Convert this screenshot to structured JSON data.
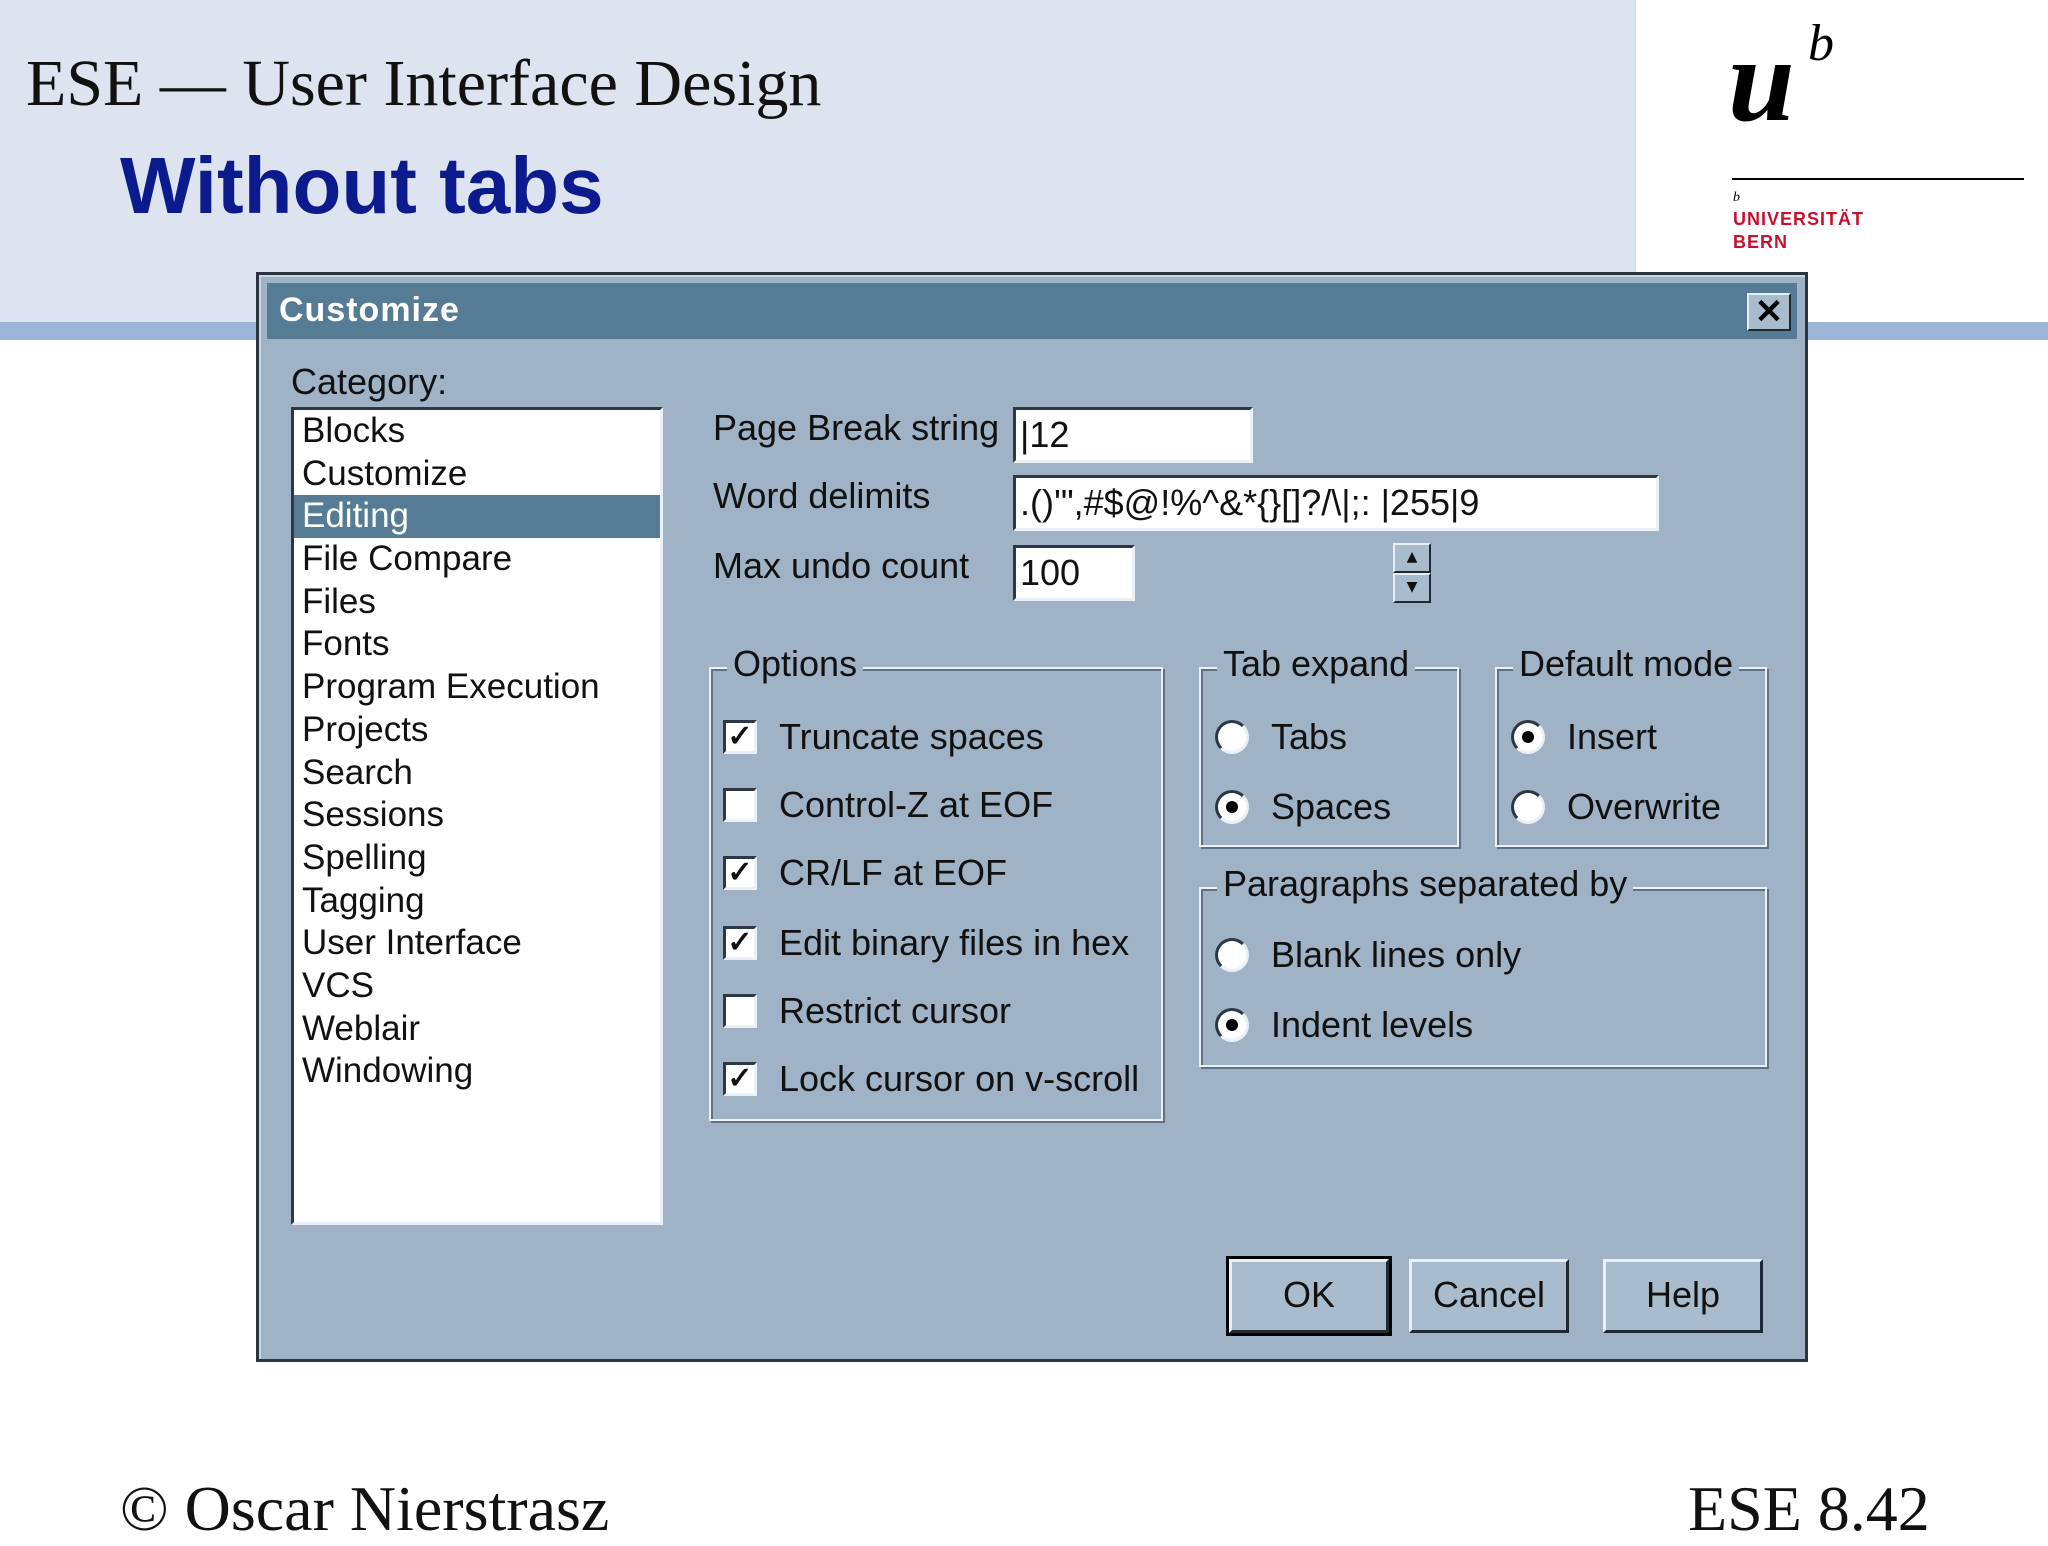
{
  "slide": {
    "course_title": "ESE — User Interface Design",
    "title": "Without tabs",
    "logo": {
      "u": "u",
      "b": "b",
      "small_b": "b",
      "line1": "UNIVERSITÄT",
      "line2": "BERN"
    },
    "footer_left": "© Oscar Nierstrasz",
    "footer_right": "ESE 8.42"
  },
  "dialog": {
    "title": "Customize",
    "close_label": "✕",
    "category_label": "Category:",
    "categories": [
      "Blocks",
      "Customize",
      "Editing",
      "File Compare",
      "Files",
      "Fonts",
      "Program Execution",
      "Projects",
      "Search",
      "Sessions",
      "Spelling",
      "Tagging",
      "User Interface",
      "VCS",
      "Weblair",
      "Windowing"
    ],
    "selected_category": "Editing",
    "page_break": {
      "label": "Page Break string",
      "value": "|12"
    },
    "word_delimits": {
      "label": "Word delimits",
      "value": ".()'\",#$@!%^&*{}[]?/\\|;: |255|9"
    },
    "max_undo": {
      "label": "Max undo count",
      "value": "100",
      "up": "▲",
      "down": "▼"
    },
    "options": {
      "title": "Options",
      "items": [
        {
          "label": "Truncate spaces",
          "checked": true
        },
        {
          "label": "Control-Z at EOF",
          "checked": false
        },
        {
          "label": "CR/LF at EOF",
          "checked": true
        },
        {
          "label": "Edit binary files in hex",
          "checked": true
        },
        {
          "label": "Restrict cursor",
          "checked": false
        },
        {
          "label": "Lock cursor on v-scroll",
          "checked": true
        }
      ]
    },
    "tab_expand": {
      "title": "Tab expand",
      "items": [
        {
          "label": "Tabs",
          "selected": false
        },
        {
          "label": "Spaces",
          "selected": true
        }
      ]
    },
    "default_mode": {
      "title": "Default mode",
      "items": [
        {
          "label": "Insert",
          "selected": true
        },
        {
          "label": "Overwrite",
          "selected": false
        }
      ]
    },
    "paragraphs": {
      "title": "Paragraphs separated by",
      "items": [
        {
          "label": "Blank lines only",
          "selected": false
        },
        {
          "label": "Indent levels",
          "selected": true
        }
      ]
    },
    "buttons": {
      "ok": "OK",
      "cancel": "Cancel",
      "help": "Help"
    },
    "check_mark": "✓"
  }
}
